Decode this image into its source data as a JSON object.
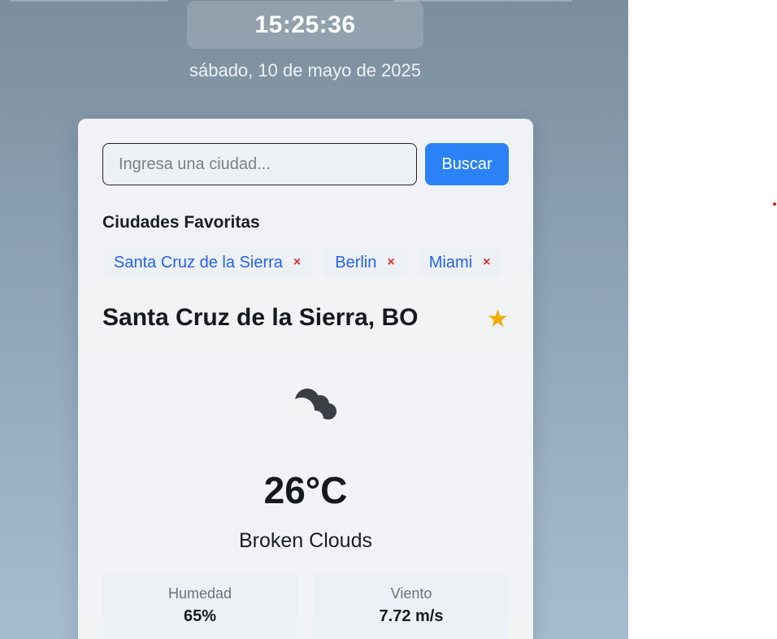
{
  "clock": {
    "time": "15:25:36",
    "date": "sábado, 10 de mayo de 2025"
  },
  "search": {
    "placeholder": "Ingresa una ciudad...",
    "value": "",
    "button_label": "Buscar"
  },
  "favorites": {
    "title": "Ciudades Favoritas",
    "items": [
      {
        "name": "Santa Cruz de la Sierra",
        "remove": "×"
      },
      {
        "name": "Berlin",
        "remove": "×"
      },
      {
        "name": "Miami",
        "remove": "×"
      }
    ]
  },
  "weather": {
    "city": "Santa Cruz de la Sierra, BO",
    "favorite_star": "★",
    "icon": "broken-clouds-icon",
    "temperature": "26°C",
    "description": "Broken Clouds",
    "stats": [
      {
        "label": "Humedad",
        "value": "65%"
      },
      {
        "label": "Viento",
        "value": "7.72 m/s"
      }
    ]
  },
  "colors": {
    "accent": "#2b82f6",
    "favorite_link": "#2563eb",
    "remove": "#e03131",
    "star": "#f0ad00"
  }
}
